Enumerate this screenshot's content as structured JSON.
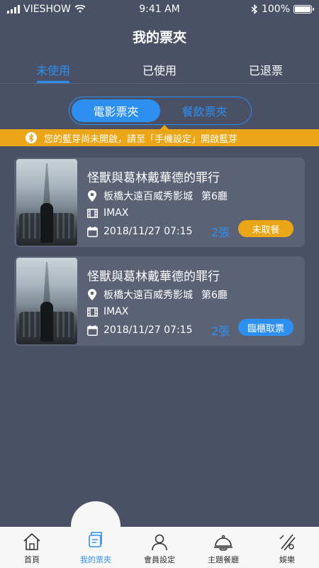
{
  "status_bar": {
    "carrier": "VIESHOW",
    "time": "9:41 AM",
    "battery": "100%",
    "battery_level": 1.0
  },
  "header": {
    "title": "我的票夾"
  },
  "tabs": [
    {
      "label": "未使用",
      "active": true
    },
    {
      "label": "已使用",
      "active": false
    },
    {
      "label": "已退票",
      "active": false
    }
  ],
  "segment": {
    "options": [
      {
        "label": "電影票夾",
        "active": true
      },
      {
        "label": "餐飲票夾",
        "active": false
      }
    ]
  },
  "bluetooth_banner": {
    "message": "您的藍芽尚未開啟，請至「手機設定」開啟藍芽"
  },
  "tickets": [
    {
      "title": "怪獸與葛林戴華德的罪行",
      "venue": "板橋大遠百威秀影城",
      "hall": "第6廳",
      "format": "IMAX",
      "datetime": "2018/11/27 07:15",
      "quantity": "2張",
      "status_label": "未取餐",
      "status_color": "#eaa616"
    },
    {
      "title": "怪獸與葛林戴華德的罪行",
      "venue": "板橋大遠百威秀影城",
      "hall": "第6廳",
      "format": "IMAX",
      "datetime": "2018/11/27 07:15",
      "quantity": "2張",
      "status_label": "臨櫃取票",
      "status_color": "#2d8ff0"
    }
  ],
  "bottom_nav": [
    {
      "label": "首頁",
      "icon": "home-icon",
      "active": false
    },
    {
      "label": "我的票夾",
      "icon": "ticket-wallet-icon",
      "active": true
    },
    {
      "label": "會員設定",
      "icon": "user-icon",
      "active": false
    },
    {
      "label": "主題餐廳",
      "icon": "cloche-icon",
      "active": false
    },
    {
      "label": "娛樂",
      "icon": "entertainment-icon",
      "active": false
    }
  ],
  "colors": {
    "background": "#4a5166",
    "card": "#5c6276",
    "accent_blue": "#2d8ff0",
    "accent_orange": "#eaa616"
  }
}
